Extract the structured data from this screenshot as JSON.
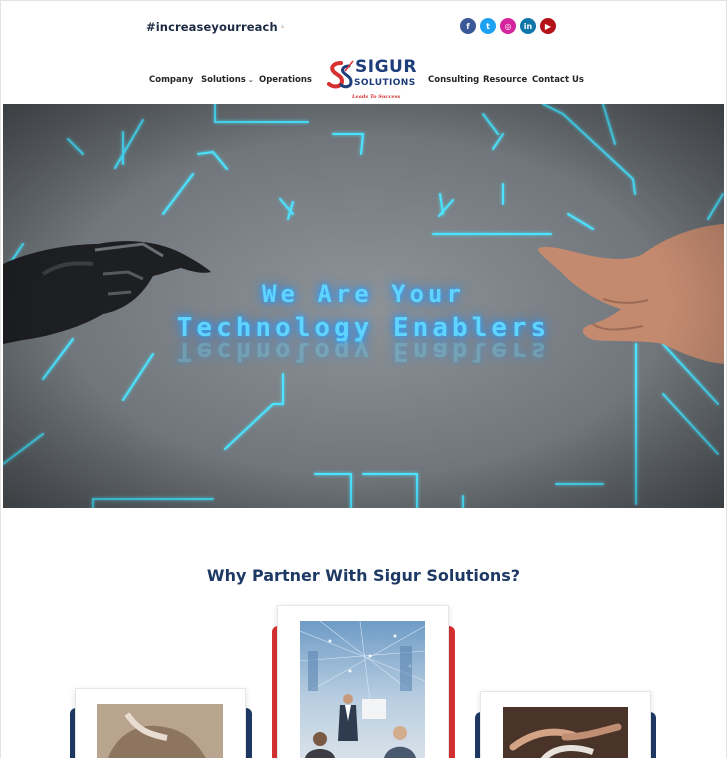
{
  "topbar": {
    "hashtag": "#increaseyourreach",
    "social": [
      {
        "name": "facebook-icon",
        "glyph": "f",
        "color": "#3b5998"
      },
      {
        "name": "twitter-icon",
        "glyph": "t",
        "color": "#1da1f2"
      },
      {
        "name": "instagram-icon",
        "glyph": "◎",
        "color": "#d6249f"
      },
      {
        "name": "linkedin-icon",
        "glyph": "in",
        "color": "#0e76a8"
      },
      {
        "name": "youtube-icon",
        "glyph": "▶",
        "color": "#b31217"
      }
    ]
  },
  "nav": {
    "company": "Company",
    "solutions": "Solutions",
    "operations": "Operations",
    "consulting": "Consulting",
    "resource": "Resource",
    "contact": "Contact Us"
  },
  "logo": {
    "word1": "SIGUR",
    "word2": "SOLUTIONS",
    "tagline": "Leads To Success"
  },
  "hero": {
    "line1": "We Are Your",
    "line2": "Technology Enablers"
  },
  "section": {
    "title": "Why Partner With Sigur Solutions?"
  },
  "colors": {
    "navy": "#1e3a64",
    "red": "#d63031",
    "neon": "#5fd4ff"
  }
}
